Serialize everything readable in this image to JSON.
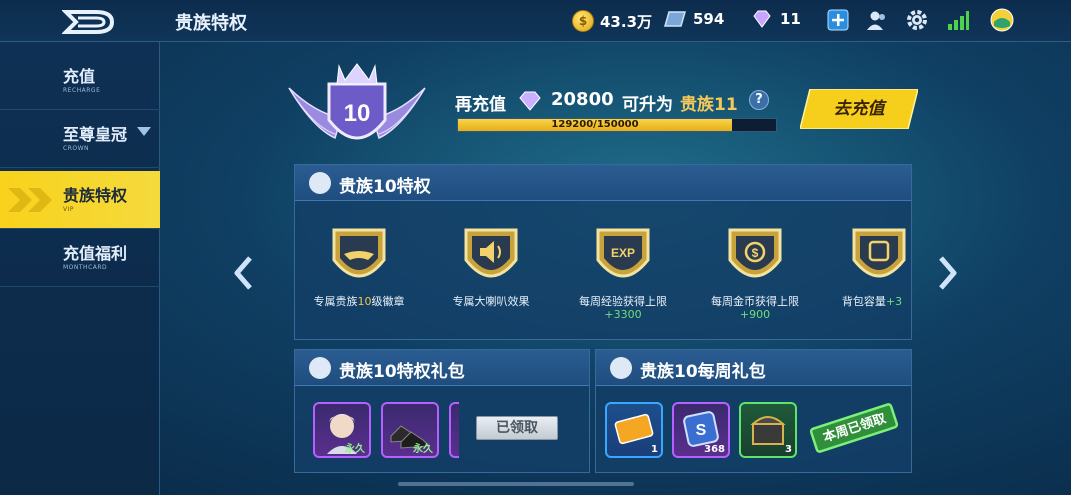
{
  "header": {
    "title": "贵族特权",
    "coins": "43.3万",
    "tickets": "594",
    "gems": "11",
    "icons": [
      "logo-icon",
      "coin-icon",
      "ticket-icon",
      "gem-icon",
      "plus-icon",
      "friends-icon",
      "gear-icon",
      "signal-icon",
      "avatar-icon"
    ]
  },
  "sidebar": {
    "items": [
      {
        "label": "充值",
        "sub": "RECHARGE"
      },
      {
        "label": "至尊皇冠",
        "sub": "CROWN"
      },
      {
        "label": "贵族特权",
        "sub": "VIP"
      },
      {
        "label": "充值福利",
        "sub": "MONTHCARD"
      }
    ],
    "active_index": 2
  },
  "vip": {
    "level": "10",
    "recharge_label": "再充值",
    "recharge_amount": "20800",
    "upgrade_prefix": "可升为",
    "upgrade_tier": "贵族11",
    "help": "?",
    "progress_text": "129200/150000",
    "progress_fraction": 0.861,
    "recharge_button": "去充值"
  },
  "privileges": {
    "title": "贵族10特权",
    "items": [
      {
        "pre": "专属贵族",
        "hl": "10",
        "post": "级徽章",
        "icon": "wing-badge-icon"
      },
      {
        "pre": "专属大喇叭效果",
        "hl": "",
        "post": "",
        "icon": "speaker-icon"
      },
      {
        "pre": "每周经验获得上限",
        "hl": "+3300",
        "post": "",
        "icon": "exp-icon"
      },
      {
        "pre": "每周金币获得上限",
        "hl": "+900",
        "post": "",
        "icon": "coin-badge-icon"
      },
      {
        "pre": "背包容量",
        "hl": "+3",
        "post": "",
        "icon": "backpack-icon"
      }
    ]
  },
  "gift_pack": {
    "title": "贵族10特权礼包",
    "items": [
      {
        "tag": "永久",
        "icon": "avatar-item-icon"
      },
      {
        "tag": "永久",
        "icon": "shoes-item-icon"
      }
    ],
    "claimed_label": "已领取"
  },
  "weekly_pack": {
    "title": "贵族10每周礼包",
    "items": [
      {
        "qty": "1",
        "icon": "ticket-item-icon"
      },
      {
        "qty": "368",
        "icon": "card-item-icon"
      },
      {
        "qty": "3",
        "icon": "chest-item-icon"
      }
    ],
    "claimed_label": "本周已领取"
  }
}
